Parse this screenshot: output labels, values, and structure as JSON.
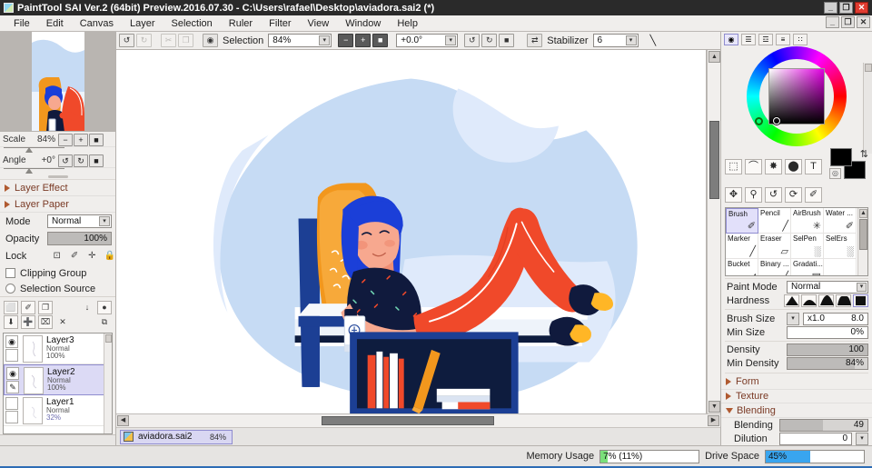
{
  "window": {
    "title": "PaintTool SAI Ver.2 (64bit) Preview.2016.07.30 - C:\\Users\\rafael\\Desktop\\aviadora.sai2 (*)",
    "icon": "app-icon",
    "controls": {
      "minimize": "_",
      "maximize": "❐",
      "close": "✕"
    },
    "doc_controls": {
      "minimize": "_",
      "maximize": "❐",
      "close": "✕"
    }
  },
  "menubar": {
    "items": [
      {
        "label": "File"
      },
      {
        "label": "Edit"
      },
      {
        "label": "Canvas"
      },
      {
        "label": "Layer"
      },
      {
        "label": "Selection"
      },
      {
        "label": "Ruler"
      },
      {
        "label": "Filter"
      },
      {
        "label": "View"
      },
      {
        "label": "Window"
      },
      {
        "label": "Help"
      }
    ]
  },
  "toolbar": {
    "undo": "↺",
    "redo": "↻",
    "cut": "✂",
    "paste": "❐",
    "selection_icon": "◉",
    "selection_label": "Selection",
    "zoom_value": "84%",
    "zoom_out": "−",
    "zoom_in": "+",
    "zoom_reset": "■",
    "angle_value": "+0.0°",
    "rotate_ccw": "↺",
    "rotate_cw": "↻",
    "rotate_reset": "■",
    "flip": "⇄",
    "stabilizer_label": "Stabilizer",
    "stabilizer_value": "6",
    "line_tool": "╲",
    "dropdown_arrow": "▾"
  },
  "navigator": {
    "scale_label": "Scale",
    "scale_value": "84%",
    "angle_label": "Angle",
    "angle_value": "+0°",
    "scale_minus": "−",
    "scale_plus": "+",
    "scale_reset": "■",
    "angle_ccw": "↺",
    "angle_cw": "↻",
    "angle_reset": "■"
  },
  "left_panel": {
    "accordions": [
      {
        "label": "Layer Effect",
        "open": false
      },
      {
        "label": "Layer Paper",
        "open": false
      }
    ],
    "mode_label": "Mode",
    "mode_value": "Normal",
    "opacity_label": "Opacity",
    "opacity_value": "100%",
    "lock_label": "Lock",
    "lock_icons": [
      "lock-alpha-icon",
      "lock-pixel-icon",
      "lock-move-icon",
      "lock-all-icon"
    ],
    "lock_glyphs": [
      "⊡",
      "✐",
      "✛",
      "ὑ2"
    ],
    "clipping_group": "Clipping Group",
    "selection_source": "Selection Source",
    "layer_tools_row1": [
      "⬜",
      "✐",
      "❐",
      "↓",
      "●"
    ],
    "layer_tools_row2": [
      "⬇",
      "➕",
      "⌧",
      "✕",
      "⧉"
    ],
    "layers": [
      {
        "name": "Layer3",
        "mode": "Normal",
        "opacity": "100%",
        "visible": true,
        "selected": false,
        "dim": false
      },
      {
        "name": "Layer2",
        "mode": "Normal",
        "opacity": "100%",
        "visible": true,
        "selected": true,
        "dim": false
      },
      {
        "name": "Layer1",
        "mode": "Normal",
        "opacity": "32%",
        "visible": false,
        "selected": false,
        "dim": true
      }
    ],
    "eye_glyph": "◉"
  },
  "right_panel": {
    "color_tabs": [
      "color-wheel-tab",
      "rgb-slider-tab",
      "hsv-slider-tab",
      "mixer-tab",
      "swatches-tab"
    ],
    "color_tab_glyphs": [
      "◉",
      "☰",
      "☲",
      "≡",
      "∷"
    ],
    "tools_row1": [
      {
        "name": "rect-select-tool",
        "glyph": "⬚"
      },
      {
        "name": "lasso-tool",
        "glyph": "⌒"
      },
      {
        "name": "magic-wand-tool",
        "glyph": "✸"
      },
      {
        "name": "move-selection-tool",
        "glyph": "⬤"
      },
      {
        "name": "text-tool",
        "glyph": "T"
      }
    ],
    "tools_row2": [
      {
        "name": "move-tool",
        "glyph": "✥"
      },
      {
        "name": "zoom-tool",
        "glyph": "⚲"
      },
      {
        "name": "rotate-tool",
        "glyph": "↺"
      },
      {
        "name": "hand-tool",
        "glyph": "⟳"
      },
      {
        "name": "eyedropper-tool",
        "glyph": "✐"
      }
    ],
    "swap_glyph": "⇅",
    "foreground_color": "#000000",
    "background_color": "#000000",
    "brushes": [
      {
        "label": "Brush",
        "glyph": "✐",
        "selected": true
      },
      {
        "label": "Pencil",
        "glyph": "╱",
        "selected": false
      },
      {
        "label": "AirBrush",
        "glyph": "✳",
        "selected": false
      },
      {
        "label": "Water ...",
        "glyph": "✐",
        "selected": false
      },
      {
        "label": "Marker",
        "glyph": "╱",
        "selected": false
      },
      {
        "label": "Eraser",
        "glyph": "▱",
        "selected": false
      },
      {
        "label": "SelPen",
        "glyph": "░",
        "selected": false
      },
      {
        "label": "SelErs",
        "glyph": "░",
        "selected": false
      },
      {
        "label": "Bucket",
        "glyph": "◢",
        "selected": false
      },
      {
        "label": "Binary ...",
        "glyph": "╱",
        "selected": false
      },
      {
        "label": "Gradati...",
        "glyph": "▤",
        "selected": false
      }
    ],
    "paint_mode_label": "Paint Mode",
    "paint_mode_value": "Normal",
    "hardness_label": "Hardness",
    "hardness_options": 5,
    "hardness_selected": 4,
    "brush_size_label": "Brush Size",
    "brush_size_mult": "x1.0",
    "brush_size_value": "8.0",
    "min_size_label": "Min Size",
    "min_size_value": "0%",
    "density_label": "Density",
    "density_value": "100",
    "min_density_label": "Min Density",
    "min_density_value": "84%",
    "sections": [
      {
        "label": "Form",
        "open": false
      },
      {
        "label": "Texture",
        "open": false
      },
      {
        "label": "Blending",
        "open": true
      }
    ],
    "blending_label": "Blending",
    "blending_value": "49",
    "dilution_label": "Dilution",
    "dilution_value": "0"
  },
  "document_tab": {
    "name": "aviadora.sai2",
    "zoom": "84%",
    "icon": "document-thumb-icon"
  },
  "statusbar": {
    "memory_label": "Memory Usage",
    "memory_value": "7% (11%)",
    "memory_percent": 7,
    "memory_color": "#7ae07a",
    "drive_label": "Drive Space",
    "drive_value": "45%",
    "drive_percent": 45,
    "drive_color": "#39a5ef"
  },
  "artwork": {
    "title": "Woman reclining in chair reading",
    "background_blob": "#c6dbf4",
    "background_blob_light": "#dfeafb",
    "chair_navy": "#1c3f94",
    "chair_orange": "#f2971d",
    "pants_orange": "#f0492a",
    "hair_blue": "#1b3fd8",
    "skin": "#f7a88f",
    "top_navy": "#101a3d",
    "sock_yellow": "#ffb626",
    "shelf_navy": "#0e1c3e"
  }
}
